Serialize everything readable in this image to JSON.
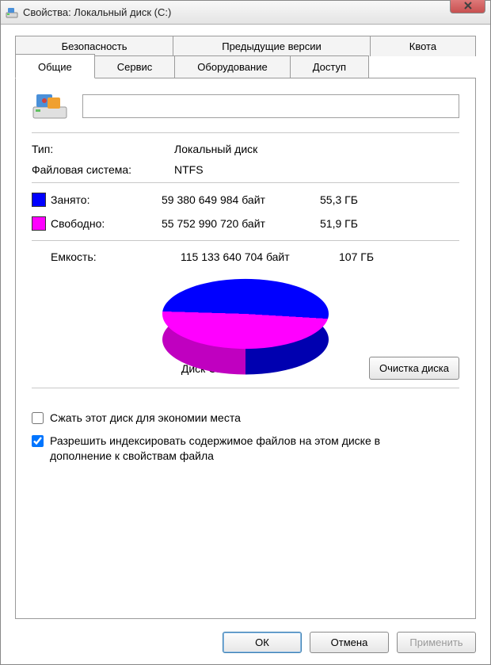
{
  "window": {
    "title": "Свойства: Локальный диск (С:)"
  },
  "tabs": {
    "top": [
      {
        "label": "Безопасность"
      },
      {
        "label": "Предыдущие версии"
      },
      {
        "label": "Квота"
      }
    ],
    "bottom": [
      {
        "label": "Общие",
        "active": true
      },
      {
        "label": "Сервис"
      },
      {
        "label": "Оборудование"
      },
      {
        "label": "Доступ"
      }
    ]
  },
  "general": {
    "label_value": "",
    "type_label": "Тип:",
    "type_value": "Локальный диск",
    "fs_label": "Файловая система:",
    "fs_value": "NTFS",
    "used_label": "Занято:",
    "used_bytes": "59 380 649 984 байт",
    "used_gb": "55,3 ГБ",
    "free_label": "Свободно:",
    "free_bytes": "55 752 990 720 байт",
    "free_gb": "51,9 ГБ",
    "capacity_label": "Емкость:",
    "capacity_bytes": "115 133 640 704 байт",
    "capacity_gb": "107 ГБ",
    "disk_caption": "Диск C:",
    "cleanup_button": "Очистка диска",
    "compress_label": "Сжать этот диск для экономии места",
    "compress_checked": false,
    "index_label": "Разрешить индексировать содержимое файлов на этом диске в дополнение к свойствам файла",
    "index_checked": true
  },
  "buttons": {
    "ok": "ОК",
    "cancel": "Отмена",
    "apply": "Применить"
  },
  "colors": {
    "used": "#0000ff",
    "free": "#ff00ff"
  },
  "chart_data": {
    "type": "pie",
    "title": "Диск C:",
    "series": [
      {
        "name": "Занято",
        "value_bytes": 59380649984,
        "value_gb": 55.3,
        "color": "#0000ff"
      },
      {
        "name": "Свободно",
        "value_bytes": 55752990720,
        "value_gb": 51.9,
        "color": "#ff00ff"
      }
    ],
    "total_bytes": 115133640704,
    "total_gb": 107
  }
}
